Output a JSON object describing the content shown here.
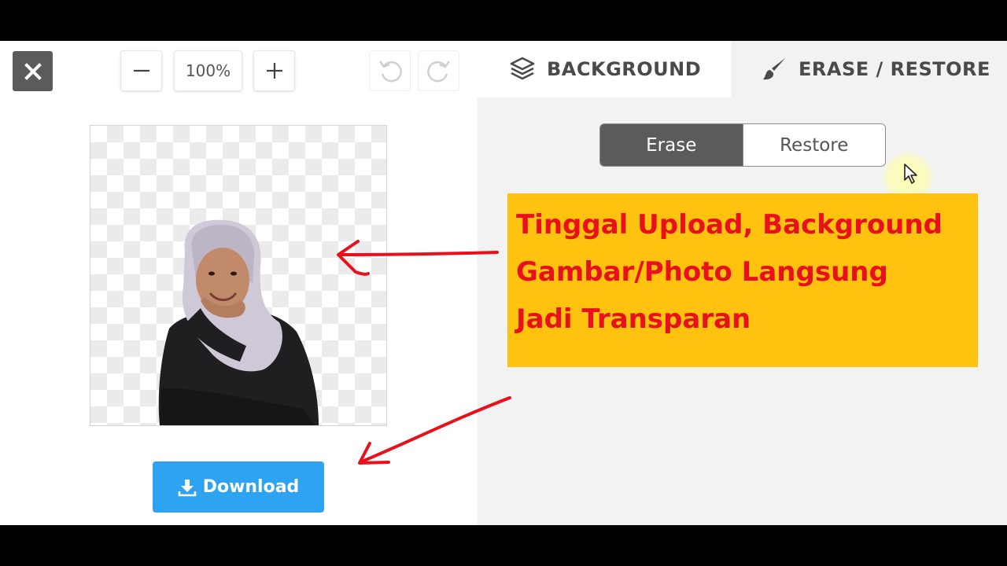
{
  "toolbar": {
    "zoom_level": "100%",
    "close_icon": "close-icon",
    "zoom_out_icon": "minus-icon",
    "zoom_in_icon": "plus-icon",
    "undo_icon": "undo-icon",
    "redo_icon": "redo-icon"
  },
  "tabs": [
    {
      "label": "BACKGROUND",
      "icon": "layers-icon"
    },
    {
      "label": "ERASE / RESTORE",
      "icon": "brush-icon"
    }
  ],
  "mode_toggle": {
    "erase_label": "Erase",
    "restore_label": "Restore",
    "selected": "Erase"
  },
  "download": {
    "label": "Download",
    "icon": "download-icon"
  },
  "annotation": {
    "lines": [
      "Tinggal Upload,  Background",
      "Gambar/Photo Langsung",
      "Jadi Transparan"
    ]
  },
  "colors": {
    "download_button": "#2ea3f2",
    "annotation_background": "#ffc20e",
    "annotation_text": "#e8101a",
    "arrow": "#e8101a"
  }
}
